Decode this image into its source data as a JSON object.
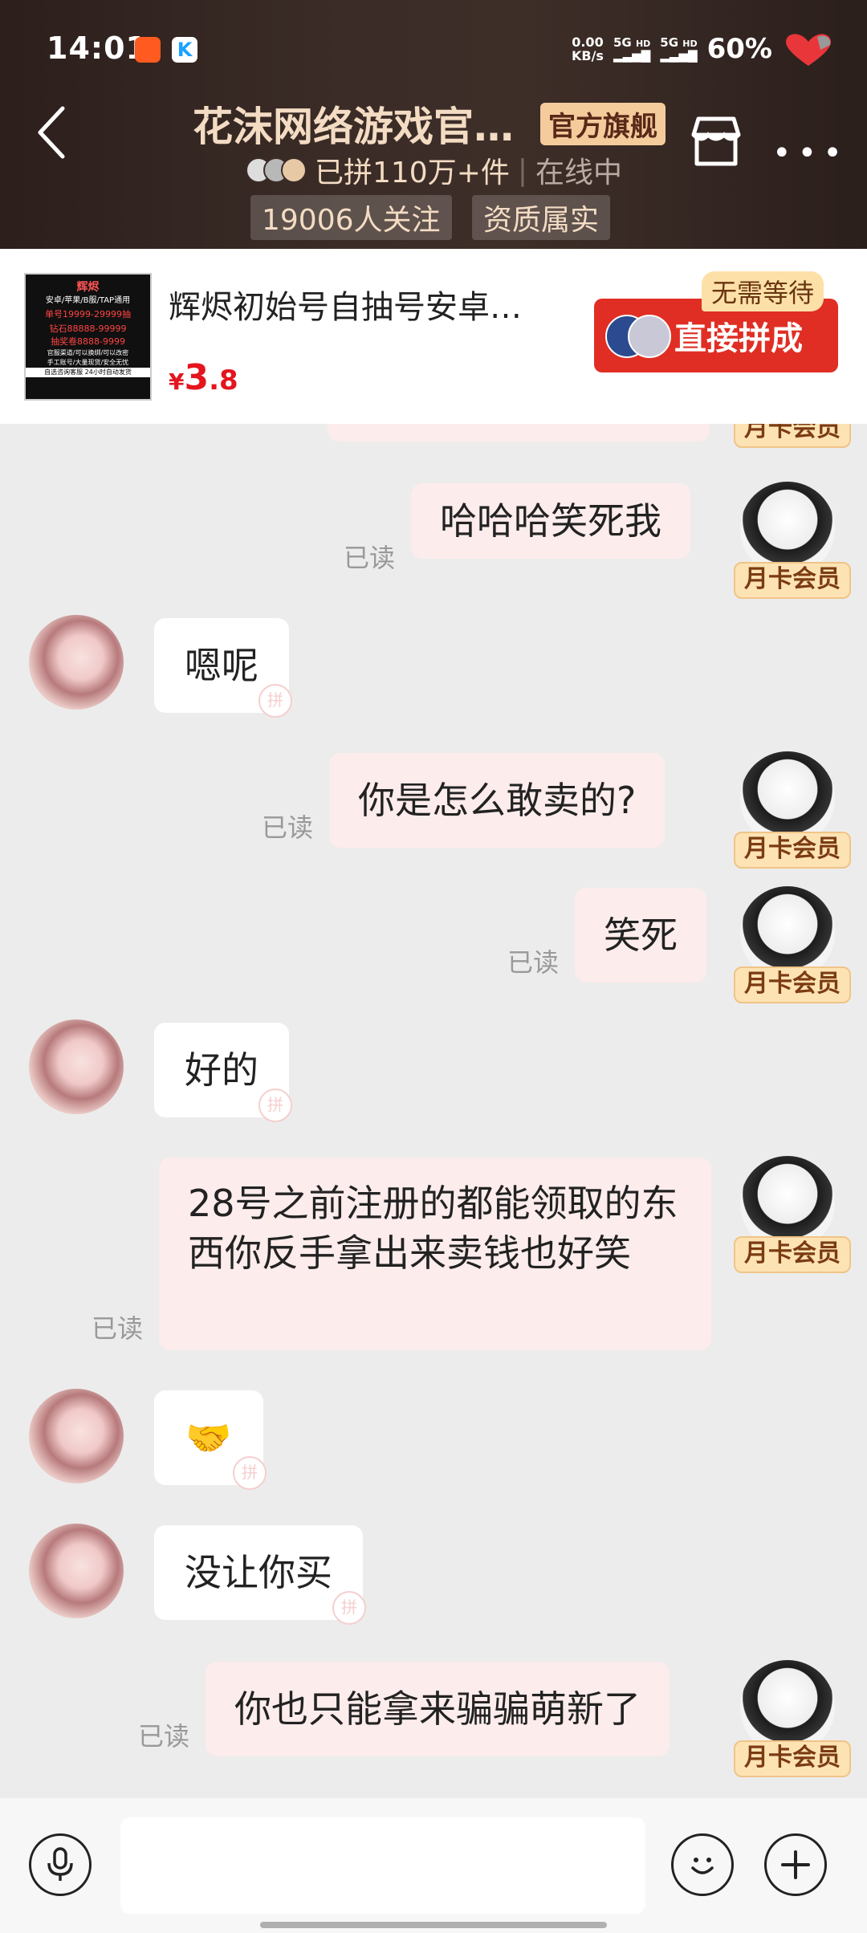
{
  "status_bar": {
    "time": "14:01",
    "net_speed": "0.00",
    "net_unit": "KB/s",
    "sig1": "5G",
    "sig1_hd": "HD",
    "sig2": "5G",
    "sig2_hd": "HD",
    "battery": "60%"
  },
  "header": {
    "shop_name": "花沫网络游戏官…",
    "badge": "官方旗舰",
    "sold": "已拼110万+件",
    "online": "在线中",
    "followers": "19006人关注",
    "verified": "资质属实"
  },
  "product": {
    "title": "辉烬初始号自抽号安卓…",
    "currency": "¥",
    "price_int": "3",
    "price_dec": ".8",
    "no_wait": "无需等待",
    "buy_label": "直接拼成",
    "thumb_lines": [
      "辉烬",
      "安卓/苹果/B服/TAP通用",
      "单号19999-29999抽",
      "钻石88888-99999",
      "抽奖卷8888-9999",
      "官服渠道/可以换绑/可以改密",
      "手工账号/大量现货/安全无忧",
      "自选咨询客服  24小时自动发货"
    ]
  },
  "chat": {
    "vip_label": "月卡会员",
    "read_label": "已读",
    "messages": [
      {
        "dir": "out",
        "text": "哈哈哈笑死我"
      },
      {
        "dir": "in",
        "text": "嗯呢"
      },
      {
        "dir": "out",
        "text": "你是怎么敢卖的?"
      },
      {
        "dir": "out",
        "text": "笑死"
      },
      {
        "dir": "in",
        "text": "好的"
      },
      {
        "dir": "out",
        "text": "28号之前注册的都能领取的东西你反手拿出来卖钱也好笑"
      },
      {
        "dir": "in",
        "text": "🤝"
      },
      {
        "dir": "in",
        "text": "没让你买"
      },
      {
        "dir": "out",
        "text": "你也只能拿来骗骗萌新了"
      }
    ]
  },
  "input_bar": {
    "placeholder": ""
  },
  "colors": {
    "header_bg": "#3b2c27",
    "title_gold": "#f3dcc3",
    "buy_red": "#e02e24",
    "price_red": "#e4151e",
    "outgoing_bubble": "#fdecec",
    "vip_bg": "#fde3b4"
  }
}
